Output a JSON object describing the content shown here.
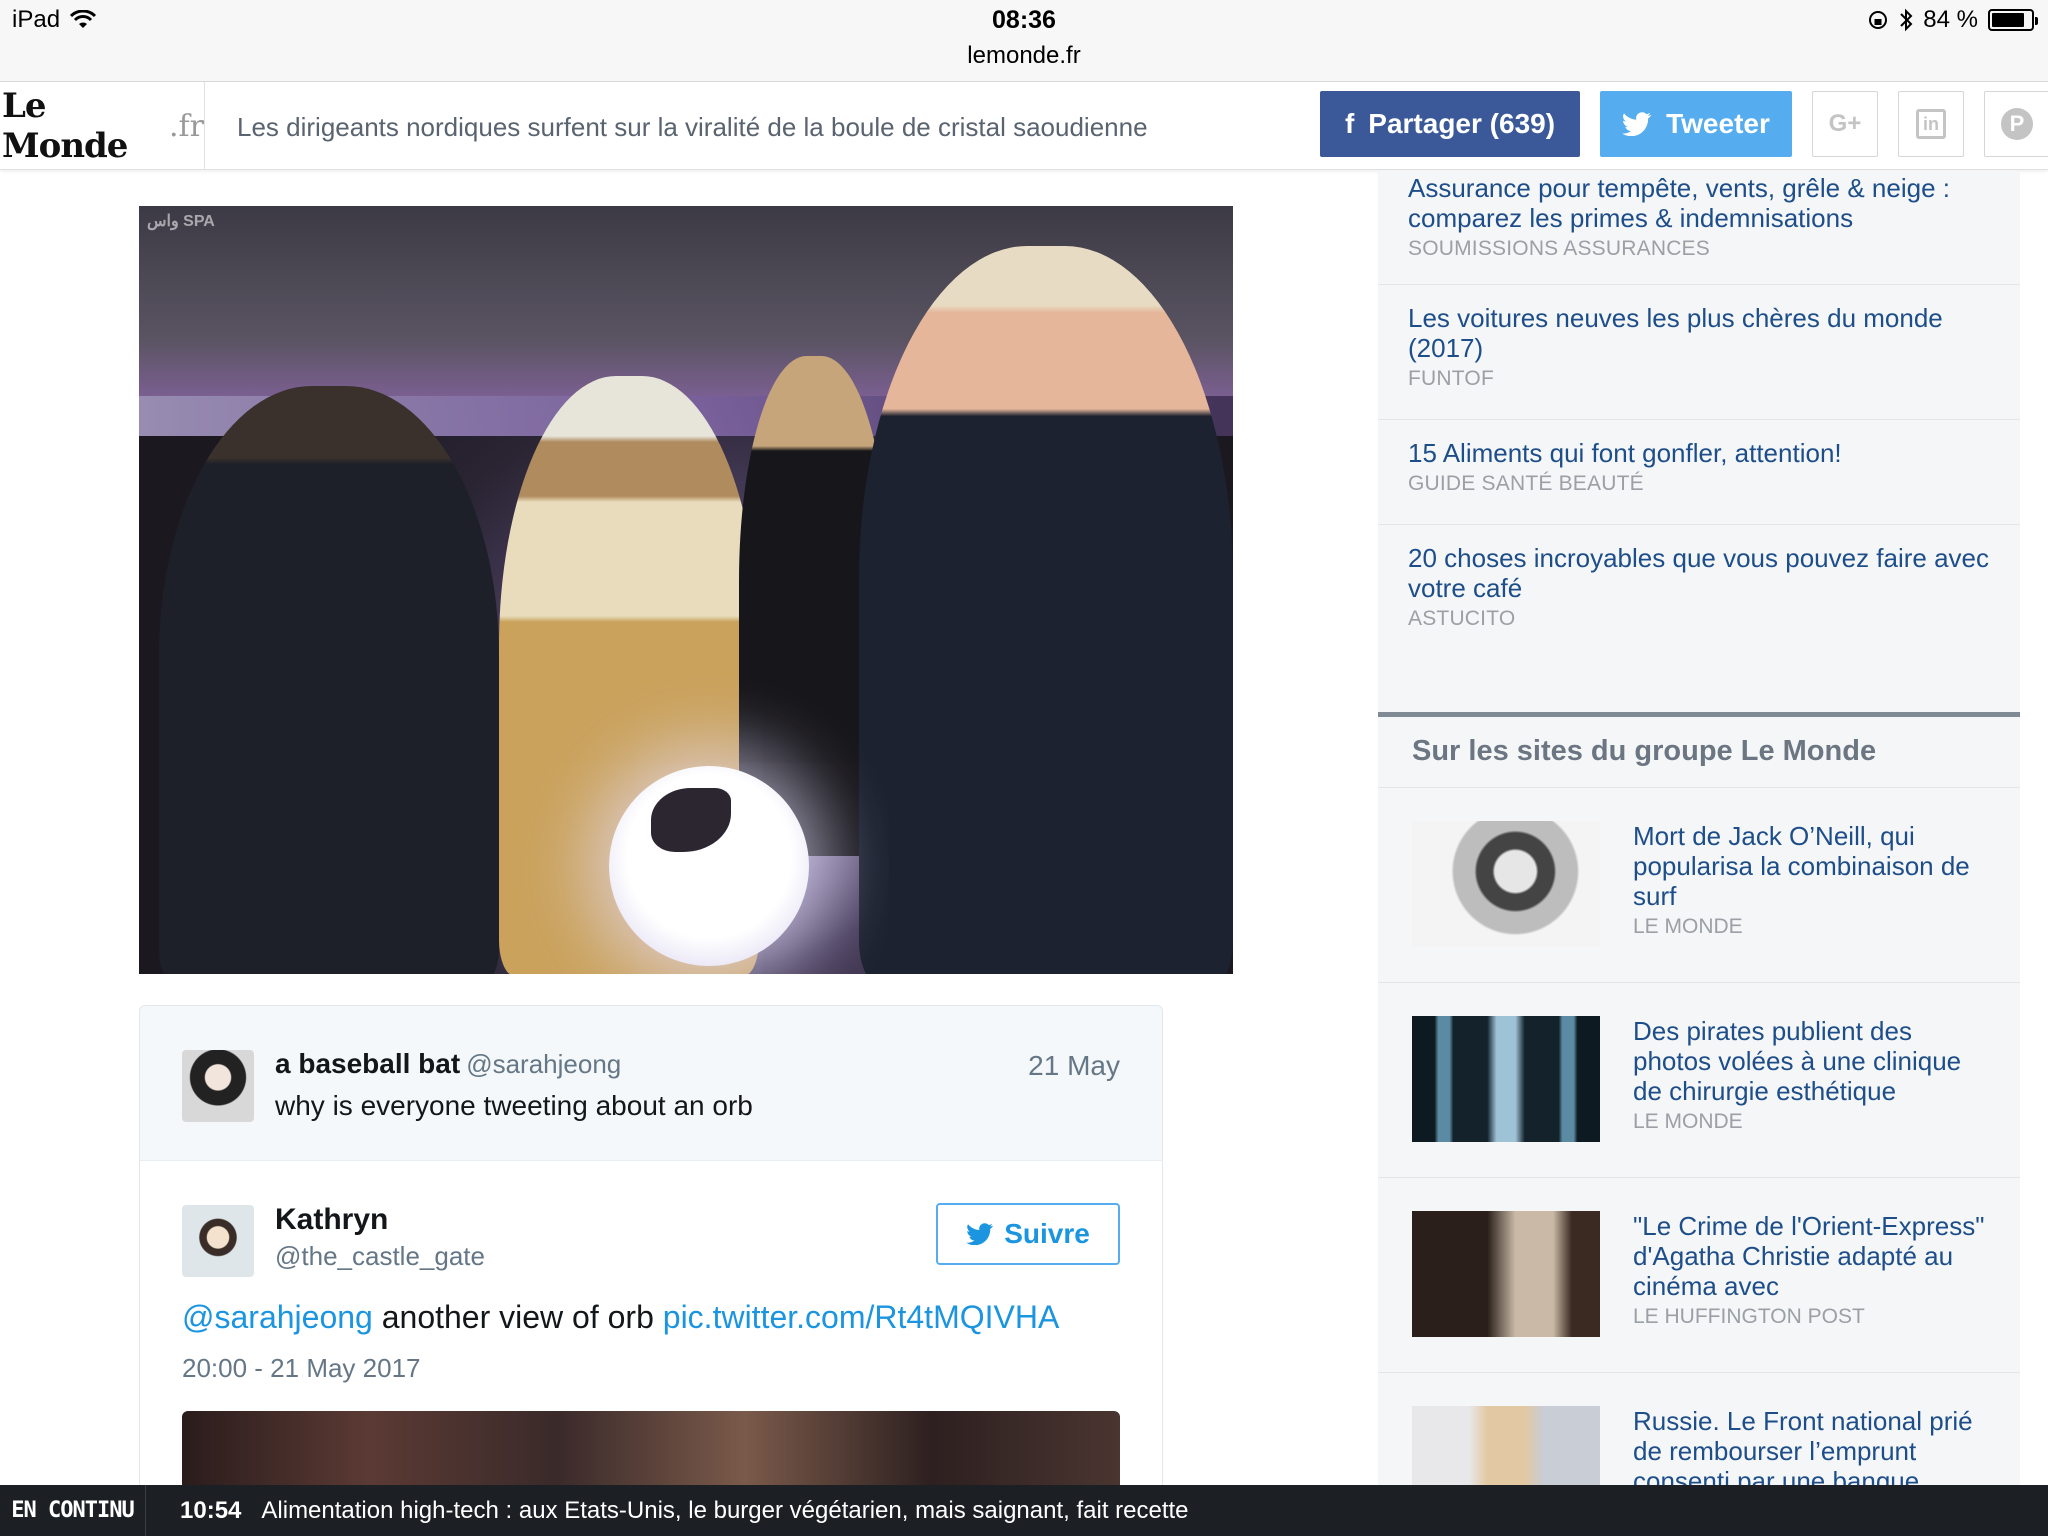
{
  "status_bar": {
    "device": "iPad",
    "time": "08:36",
    "url": "lemonde.fr",
    "battery": "84 %",
    "battery_level": 0.84
  },
  "header": {
    "logo_main": "Le Monde",
    "logo_suffix": ".fr",
    "title": "Les dirigeants nordiques surfent sur la viralité de la boule de cristal saoudienne",
    "share_facebook": "Partager (639)",
    "share_twitter": "Tweeter",
    "icons": [
      "facebook-icon",
      "twitter-icon",
      "google-plus-icon",
      "linkedin-icon",
      "pinterest-icon"
    ],
    "colors": {
      "facebook": "#3b5998",
      "twitter": "#55acee"
    }
  },
  "article": {
    "image_watermark": "واس SPA",
    "tweet_reply": {
      "name": "a baseball bat",
      "handle": "@sarahjeong",
      "date": "21 May",
      "text": "why is everyone tweeting about an orb"
    },
    "tweet": {
      "name": "Kathryn",
      "handle": "@the_castle_gate",
      "follow_label": "Suivre",
      "mention": "@sarahjeong",
      "text": "another view of orb",
      "link": "pic.twitter.com/Rt4tMQIVHA",
      "timestamp": "20:00 - 21 May 2017"
    }
  },
  "sidebar": {
    "ads": [
      {
        "title": "Assurance pour tempête, vents, grêle & neige : comparez les primes & indemnisations",
        "source": "SOUMISSIONS ASSURANCES"
      },
      {
        "title": "Les voitures neuves les plus chères du monde (2017)",
        "source": "FUNTOF"
      },
      {
        "title": "15 Aliments qui font gonfler, attention!",
        "source": "GUIDE SANTÉ BEAUTÉ"
      },
      {
        "title": "20 choses incroyables que vous pouvez faire avec votre café",
        "source": "ASTUCITO"
      }
    ],
    "group_heading": "Sur les sites du groupe Le Monde",
    "news": [
      {
        "title": "Mort de Jack O’Neill, qui popularisa la combinaison de surf",
        "source": "LE MONDE"
      },
      {
        "title": "Des pirates publient des photos volées à une clinique de chirurgie esthétique",
        "source": "LE MONDE"
      },
      {
        "title": "\"Le Crime de l'Orient-Express\" d'Agatha Christie adapté au cinéma avec",
        "source": "LE HUFFINGTON POST"
      },
      {
        "title": "Russie. Le Front national prié de rembourser l’emprunt consenti par une banque",
        "source": ""
      }
    ]
  },
  "ticker": {
    "label": "EN CONTINU",
    "time": "10:54",
    "text": "Alimentation high-tech : aux Etats-Unis, le burger végétarien, mais saignant, fait recette"
  }
}
